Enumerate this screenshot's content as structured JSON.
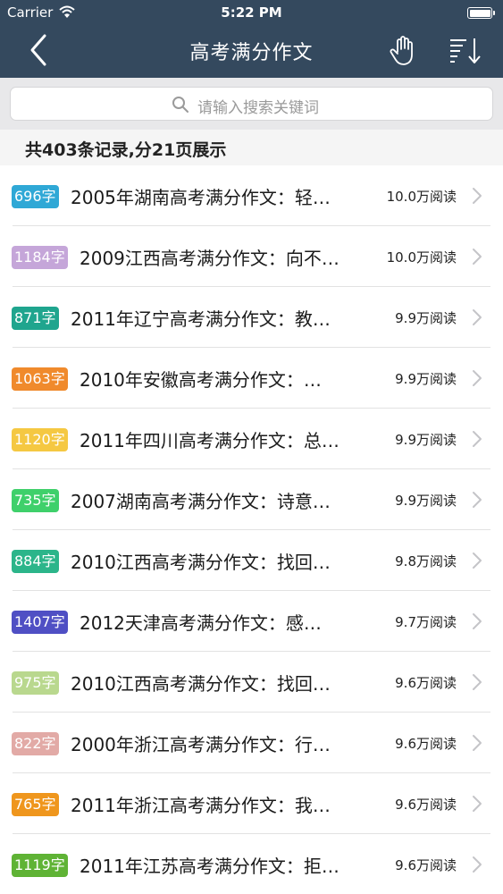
{
  "status": {
    "carrier": "Carrier",
    "time": "5:22 PM"
  },
  "nav": {
    "title": "高考满分作文"
  },
  "search": {
    "placeholder": "请输入搜索关键词"
  },
  "summary": "共403条记录,分21页展示",
  "colors": {
    "topbar": "#34495e"
  },
  "list": [
    {
      "badge": "696字",
      "badge_color": "#2fa8d6",
      "title": "2005年湖南高考满分作文：轻…",
      "reads": "10.0万阅读"
    },
    {
      "badge": "1184字",
      "badge_color": "#c5a6d9",
      "title": "2009江西高考满分作文：向不…",
      "reads": "10.0万阅读"
    },
    {
      "badge": "871字",
      "badge_color": "#1fa58e",
      "title": "2011年辽宁高考满分作文：教…",
      "reads": "9.9万阅读"
    },
    {
      "badge": "1063字",
      "badge_color": "#f08a2c",
      "title": "2010年安徽高考满分作文：…",
      "reads": "9.9万阅读"
    },
    {
      "badge": "1120字",
      "badge_color": "#f5c842",
      "title": "2011年四川高考满分作文：总…",
      "reads": "9.9万阅读"
    },
    {
      "badge": "735字",
      "badge_color": "#3fd06b",
      "title": "2007湖南高考满分作文：诗意…",
      "reads": "9.9万阅读"
    },
    {
      "badge": "884字",
      "badge_color": "#2cb58a",
      "title": "2010江西高考满分作文：找回…",
      "reads": "9.8万阅读"
    },
    {
      "badge": "1407字",
      "badge_color": "#4f4fc4",
      "title": "2012天津高考满分作文：感…",
      "reads": "9.7万阅读"
    },
    {
      "badge": "975字",
      "badge_color": "#b9d88e",
      "title": "2010江西高考满分作文：找回…",
      "reads": "9.6万阅读"
    },
    {
      "badge": "822字",
      "badge_color": "#e2aaa6",
      "title": "2000年浙江高考满分作文：行…",
      "reads": "9.6万阅读"
    },
    {
      "badge": "765字",
      "badge_color": "#ef961d",
      "title": "2011年浙江高考满分作文：我…",
      "reads": "9.6万阅读"
    },
    {
      "badge": "1119字",
      "badge_color": "#5fb335",
      "title": "2011年江苏高考满分作文：拒…",
      "reads": "9.6万阅读"
    }
  ]
}
